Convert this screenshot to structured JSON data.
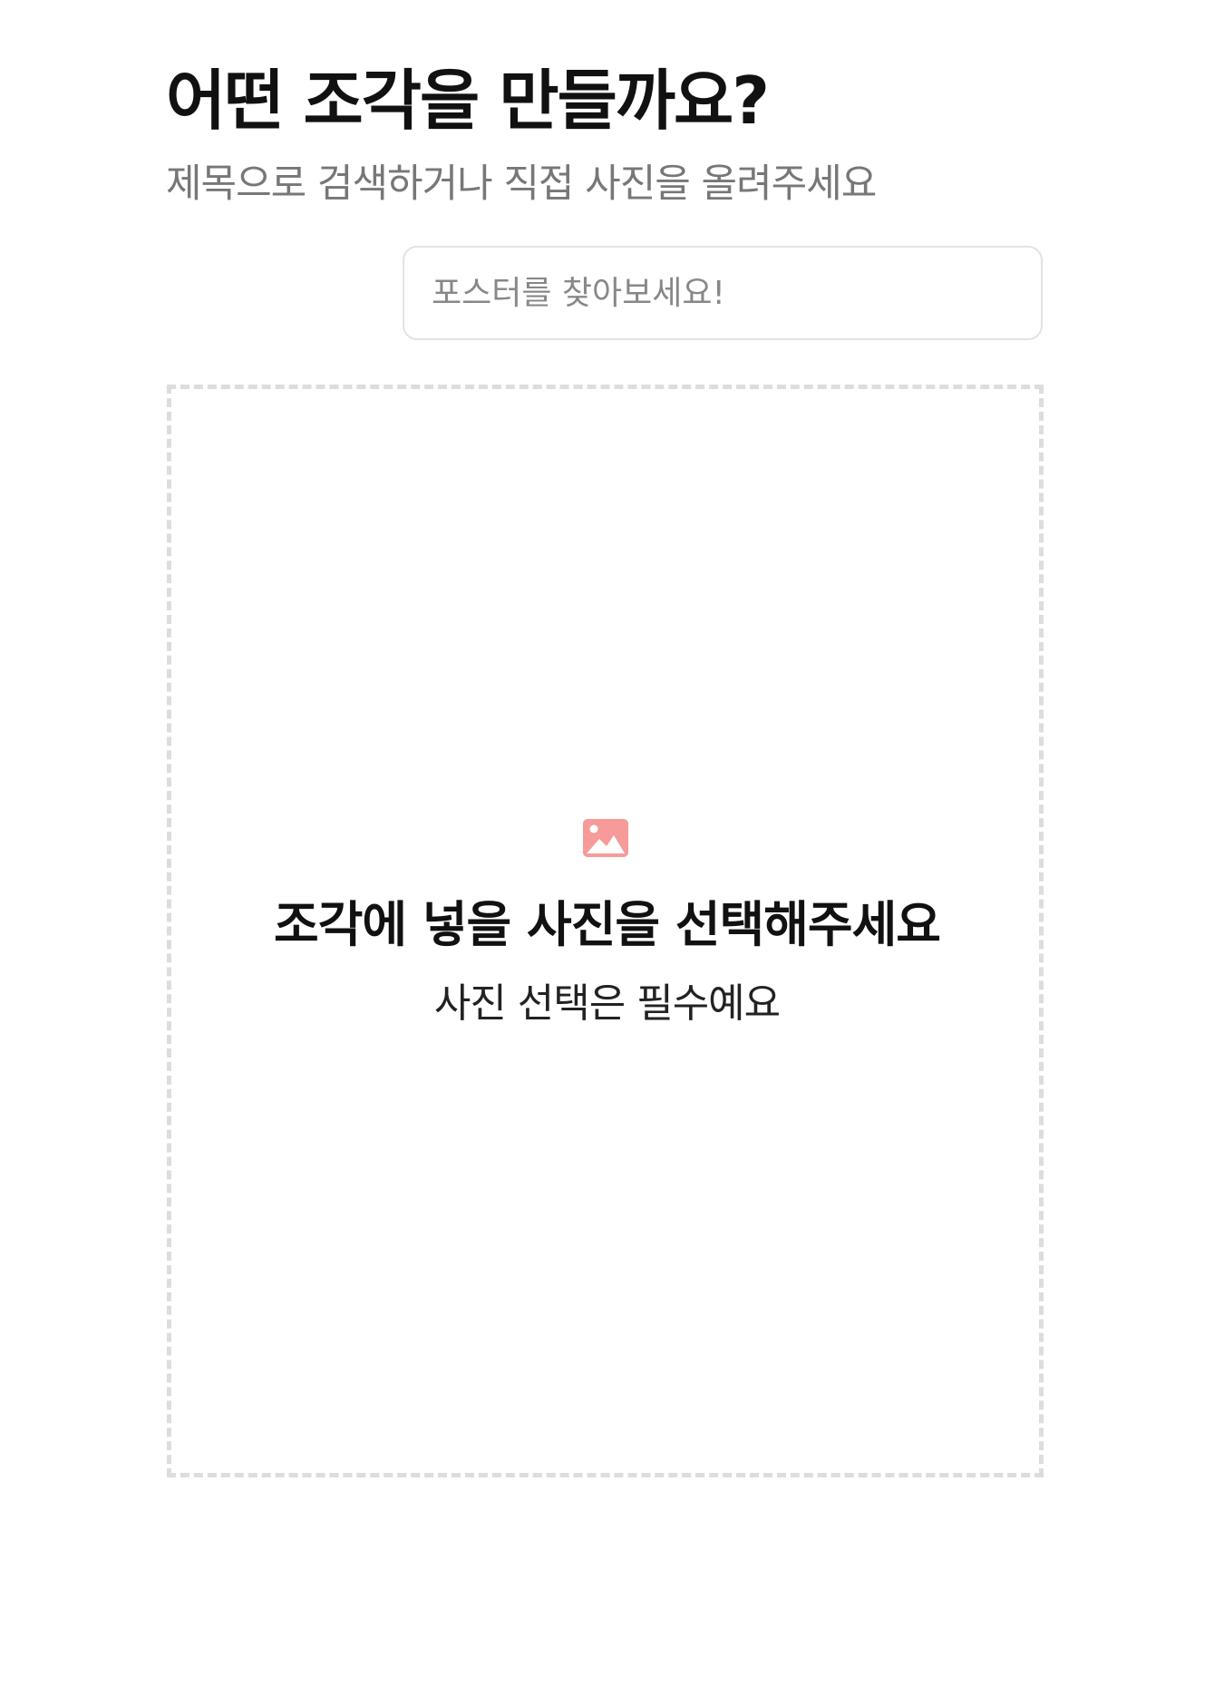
{
  "header": {
    "title": "어떤 조각을 만들까요?",
    "subtitle": "제목으로 검색하거나 직접 사진을 올려주세요"
  },
  "search": {
    "placeholder": "포스터를 찾아보세요!",
    "value": ""
  },
  "upload": {
    "icon": "image-icon",
    "icon_color": "#f79a9a",
    "title": "조각에 넣을 사진을 선택해주세요",
    "subtitle": "사진 선택은 필수예요"
  }
}
